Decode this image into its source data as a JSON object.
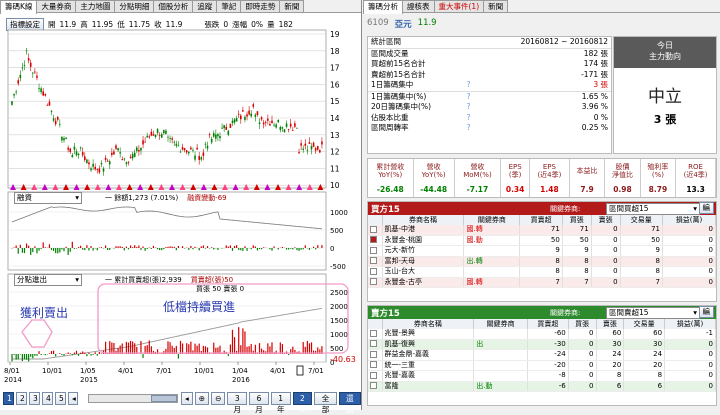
{
  "left_tabs": [
    "籌碼K線",
    "大量券商",
    "主力地圖",
    "分點明細",
    "個股分析",
    "追蹤",
    "筆記",
    "即時走勢",
    "新聞"
  ],
  "settings_btn": "指標設定",
  "price_info": {
    "open_label": "開",
    "open": "11.9",
    "high_label": "高",
    "high": "11.95",
    "low_label": "低",
    "low": "11.75",
    "close_label": "收",
    "close": "11.9",
    "change_label": "張跌",
    "change": "0",
    "pct_label": "漲幅",
    "pct": "0%",
    "vol_label": "量",
    "vol": "182"
  },
  "price_axis": [
    "19",
    "18",
    "17",
    "16",
    "15",
    "14",
    "13",
    "12",
    "11",
    "10"
  ],
  "ind1": {
    "select": "融資",
    "line_label": "一 餘額1,273 (7.01%)",
    "bar_label": "融資變動-69",
    "axis": [
      "1000",
      "500",
      "0",
      "-500"
    ]
  },
  "ind2": {
    "select": "分點進出",
    "line_label": "一 累計買賣超(張)2,939",
    "bar_label": "買賣超(張)50",
    "vol_label": "買張 50 賣張 0",
    "axis": [
      "2500",
      "2000",
      "1500",
      "1000",
      "500",
      "0"
    ],
    "last_value": "-40.63"
  },
  "annotations": {
    "left": "獲利賣出",
    "right": "低檔持續買進"
  },
  "x_months": [
    "8/01",
    "10/01",
    "1/05",
    "4/01",
    "7/01",
    "10/01",
    "1/04",
    "4/01",
    "7/01"
  ],
  "x_years": [
    "2014",
    "",
    "2015",
    "",
    "",
    "",
    "2016",
    "",
    ""
  ],
  "pages": [
    "1",
    "2",
    "3",
    "4",
    "5"
  ],
  "range_buttons": [
    "3月",
    "6月",
    "1年",
    "2年",
    "全部",
    "還價"
  ],
  "range_active": "2年",
  "right_tabs": [
    "籌碼分析",
    "證核表",
    "重大事件(1)",
    "新聞"
  ],
  "stock": {
    "code": "6109",
    "name": "亞元",
    "price": "11.9"
  },
  "stats": [
    {
      "label": "統計區間",
      "value": "20160812 ~ 20160812",
      "color": "#000"
    },
    {
      "label": "區間成交量",
      "value": "182 張",
      "color": "#000"
    },
    {
      "label": "買超前15名合計",
      "value": "174 張",
      "color": "#000"
    },
    {
      "label": "賣超前15名合計",
      "value": "-171 張",
      "color": "#000"
    },
    {
      "label": "1日籌碼集中",
      "value": "3 張",
      "color": "#d40000"
    },
    {
      "label": "1日籌碼集中(%)",
      "value": "1.65 %",
      "color": "#000"
    },
    {
      "label": "20日籌碼集中(%)",
      "value": "3.96 %",
      "color": "#000"
    },
    {
      "label": "佔股本比重",
      "value": "0 %",
      "color": "#000"
    },
    {
      "label": "區間周轉率",
      "value": "0.25 %",
      "color": "#000"
    }
  ],
  "summary": {
    "title": "今日",
    "sub": "主力動向",
    "state": "中立",
    "amount": "3 張"
  },
  "fin_headers": [
    [
      "累計營收",
      "YoY(%)"
    ],
    [
      "營收",
      "YoY(%)"
    ],
    [
      "營收",
      "MoM(%)"
    ],
    [
      "EPS",
      "(季)"
    ],
    [
      "EPS",
      "(近4季)"
    ],
    [
      "本益比",
      ""
    ],
    [
      "股價",
      "淨值比"
    ],
    [
      "殖利率",
      "(%)"
    ],
    [
      "ROE",
      "(近4季)"
    ]
  ],
  "fin_values": [
    {
      "v": "-26.48",
      "c": "#008000"
    },
    {
      "v": "-44.48",
      "c": "#008000"
    },
    {
      "v": "-7.17",
      "c": "#008000"
    },
    {
      "v": "0.34",
      "c": "#d40000"
    },
    {
      "v": "1.48",
      "c": "#d40000"
    },
    {
      "v": "7.9",
      "c": "#8b1b1b"
    },
    {
      "v": "0.98",
      "c": "#8b1b1b"
    },
    {
      "v": "8.79",
      "c": "#8b1b1b"
    },
    {
      "v": "13.3",
      "c": "#000"
    }
  ],
  "buy": {
    "title": "買方15",
    "filter_label": "關鍵券商:",
    "filter_value": "區間買超15",
    "btn": "編",
    "headers": [
      "券商名稱",
      "關鍵券商",
      "買賣超",
      "買張",
      "賣張",
      "交易量",
      "損益(萬)"
    ],
    "rows": [
      {
        "name": "凱基-中港",
        "key": "國.轉",
        "net": "71",
        "buy": "71",
        "sell": "0",
        "vol": "71",
        "pl": "0",
        "chk": false
      },
      {
        "name": "永豐金-桃園",
        "key": "國.動",
        "net": "50",
        "buy": "50",
        "sell": "0",
        "vol": "50",
        "pl": "0",
        "chk": true
      },
      {
        "name": "元大-新竹",
        "key": "",
        "net": "9",
        "buy": "9",
        "sell": "0",
        "vol": "9",
        "pl": "0",
        "chk": false
      },
      {
        "name": "富邦-天母",
        "key": "出.轉",
        "net": "8",
        "buy": "8",
        "sell": "0",
        "vol": "8",
        "pl": "0",
        "chk": false
      },
      {
        "name": "玉山-台大",
        "key": "",
        "net": "8",
        "buy": "8",
        "sell": "0",
        "vol": "8",
        "pl": "0",
        "chk": false
      },
      {
        "name": "永豐金-古亭",
        "key": "國.轉",
        "net": "7",
        "buy": "7",
        "sell": "0",
        "vol": "7",
        "pl": "0",
        "chk": false
      }
    ]
  },
  "sell": {
    "title": "賣方15",
    "filter_label": "關鍵券商:",
    "filter_value": "區間賣超15",
    "btn": "編",
    "headers": [
      "券商名稱",
      "關鍵券商",
      "買賣超",
      "買張",
      "賣張",
      "交易量",
      "損益(萬)"
    ],
    "rows": [
      {
        "name": "兆豐-景興",
        "key": "",
        "net": "-60",
        "buy": "0",
        "sell": "60",
        "vol": "60",
        "pl": "-1"
      },
      {
        "name": "凱基-復興",
        "key": "出",
        "net": "-30",
        "buy": "0",
        "sell": "30",
        "vol": "30",
        "pl": "0"
      },
      {
        "name": "群益金鼎-嘉義",
        "key": "",
        "net": "-24",
        "buy": "0",
        "sell": "24",
        "vol": "24",
        "pl": "0"
      },
      {
        "name": "統一-三重",
        "key": "",
        "net": "-20",
        "buy": "0",
        "sell": "20",
        "vol": "20",
        "pl": "0"
      },
      {
        "name": "兆豐-嘉義",
        "key": "",
        "net": "-8",
        "buy": "0",
        "sell": "8",
        "vol": "8",
        "pl": "0"
      },
      {
        "name": "富隆",
        "key": "出.動",
        "net": "-6",
        "buy": "0",
        "sell": "6",
        "vol": "6",
        "pl": "0"
      }
    ]
  },
  "colors": {
    "up": "#d40000",
    "down": "#008000",
    "accent": "#2c5fa8",
    "buyhdr": "#b31b1b",
    "sellhdr": "#2d8a2d"
  }
}
